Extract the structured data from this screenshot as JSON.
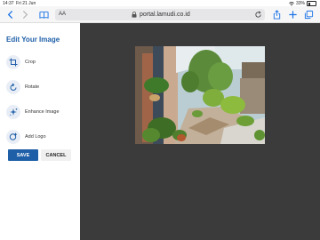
{
  "status": {
    "time": "14:37",
    "date": "Fri 21 Jun",
    "battery": "33%"
  },
  "browser": {
    "text_size_label": "AA",
    "url": "portal.lamudi.co.id"
  },
  "editor": {
    "title": "Edit Your Image",
    "tools": [
      {
        "label": "Crop",
        "icon": "crop-icon"
      },
      {
        "label": "Rotate",
        "icon": "rotate-icon"
      },
      {
        "label": "Enhance Image",
        "icon": "sparkle-icon"
      },
      {
        "label": "Add Logo",
        "icon": "logo-icon"
      }
    ],
    "save_label": "SAVE",
    "cancel_label": "CANCEL"
  },
  "colors": {
    "accent": "#1f5fa8",
    "canvas": "#3b3b3b",
    "browser_link": "#1a73e8"
  }
}
